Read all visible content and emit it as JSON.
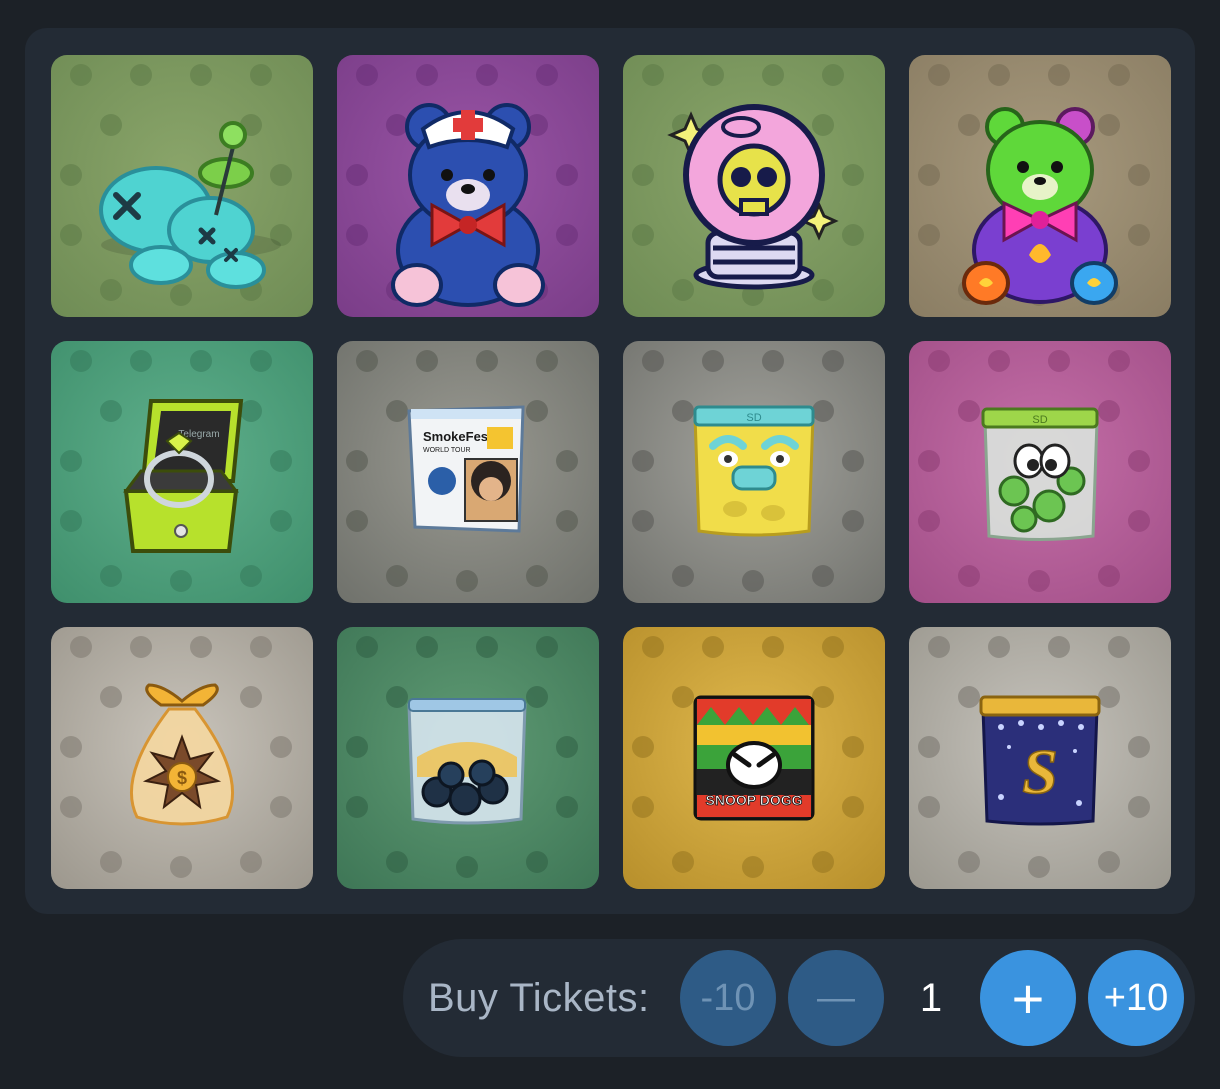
{
  "tiles": [
    {
      "name": "voodoo-doll",
      "bg": [
        "#8aa56a",
        "#6f8c55"
      ],
      "pattern": "#5d7a47"
    },
    {
      "name": "nurse-teddy-bear",
      "bg": [
        "#9a55a6",
        "#7a3d88"
      ],
      "pattern": "#6a2f78"
    },
    {
      "name": "skull-crystal-ball",
      "bg": [
        "#8aa56a",
        "#6f8c55"
      ],
      "pattern": "#5d7a47"
    },
    {
      "name": "green-teddy-bear",
      "bg": [
        "#a89a7e",
        "#8a7d63"
      ],
      "pattern": "#776b53"
    },
    {
      "name": "ring-box",
      "bg": [
        "#5fb08c",
        "#3f8f6c"
      ],
      "pattern": "#347a5b"
    },
    {
      "name": "smokefest-bag",
      "bg": [
        "#9a9a92",
        "#6f716b"
      ],
      "pattern": "#54574f"
    },
    {
      "name": "yellow-face-bag",
      "bg": [
        "#a3a39d",
        "#72736e"
      ],
      "pattern": "#575853"
    },
    {
      "name": "green-eyes-bag",
      "bg": [
        "#c56fa8",
        "#a24f88"
      ],
      "pattern": "#8c3c72"
    },
    {
      "name": "dollar-leaf-bag",
      "bg": [
        "#c9c4bb",
        "#9c978d"
      ],
      "pattern": "#7d786f"
    },
    {
      "name": "dark-berries-bag",
      "bg": [
        "#5f9b74",
        "#3e7656"
      ],
      "pattern": "#2f5f44"
    },
    {
      "name": "snoop-dogg-bag",
      "bg": [
        "#e0b84d",
        "#b78f2b"
      ],
      "pattern": "#96751f"
    },
    {
      "name": "blue-s-bag",
      "bg": [
        "#c6c3bc",
        "#9b988f"
      ],
      "pattern": "#76736b"
    }
  ],
  "texts": {
    "smokefest_title": "SmokeFest",
    "smokefest_sub": "WORLD TOUR",
    "sd_mark": "SD",
    "snoop_label": "SNOOP DOGG",
    "dollar_mark": "$",
    "s_mark": "S",
    "telegram_mark": "Telegram"
  },
  "ticket_bar": {
    "label": "Buy Tickets:",
    "minus_ten": "-10",
    "minus": "—",
    "quantity": "1",
    "plus": "+",
    "plus_ten": "+10"
  }
}
